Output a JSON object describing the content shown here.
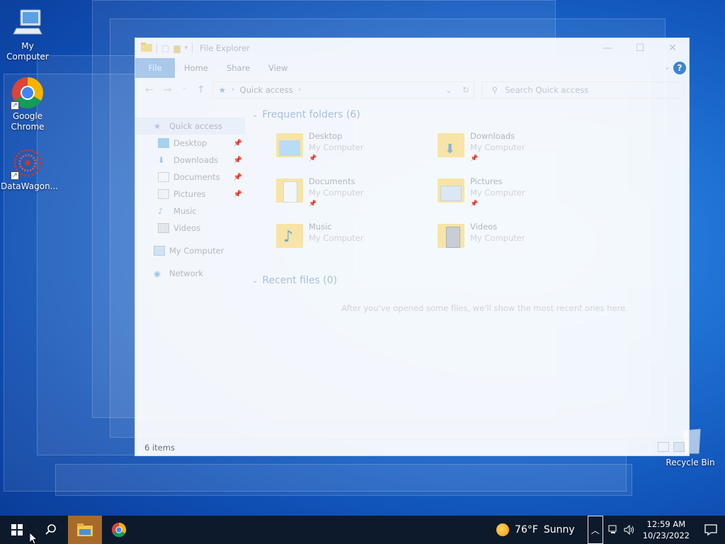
{
  "desktop": {
    "icons": [
      {
        "label": "My Computer"
      },
      {
        "label": "Google Chrome"
      },
      {
        "label": "DataWagon..."
      },
      {
        "label": "Recycle Bin"
      }
    ]
  },
  "explorer": {
    "title": "File Explorer",
    "ribbon_tabs": [
      "File",
      "Home",
      "Share",
      "View"
    ],
    "address": "Quick access",
    "search_placeholder": "Search Quick access",
    "nav": {
      "quick_access": "Quick access",
      "pinned": [
        {
          "label": "Desktop",
          "icon": "desktop-icon"
        },
        {
          "label": "Downloads",
          "icon": "download-icon"
        },
        {
          "label": "Documents",
          "icon": "document-icon"
        },
        {
          "label": "Pictures",
          "icon": "picture-icon"
        },
        {
          "label": "Music",
          "icon": "music-icon"
        },
        {
          "label": "Videos",
          "icon": "video-icon"
        }
      ],
      "this_pc": "My Computer",
      "network": "Network"
    },
    "frequent_header": "Frequent folders (6)",
    "folders": [
      {
        "name": "Desktop",
        "location": "My Computer"
      },
      {
        "name": "Downloads",
        "location": "My Computer"
      },
      {
        "name": "Documents",
        "location": "My Computer"
      },
      {
        "name": "Pictures",
        "location": "My Computer"
      },
      {
        "name": "Music",
        "location": "My Computer"
      },
      {
        "name": "Videos",
        "location": "My Computer"
      }
    ],
    "recent_header": "Recent files (0)",
    "recent_empty_message": "After you've opened some files, we'll show the most recent ones here.",
    "status_items": "6 items"
  },
  "taskbar": {
    "weather_temp": "76°F",
    "weather_condition": "Sunny",
    "time": "12:59 AM",
    "date": "10/23/2022"
  }
}
